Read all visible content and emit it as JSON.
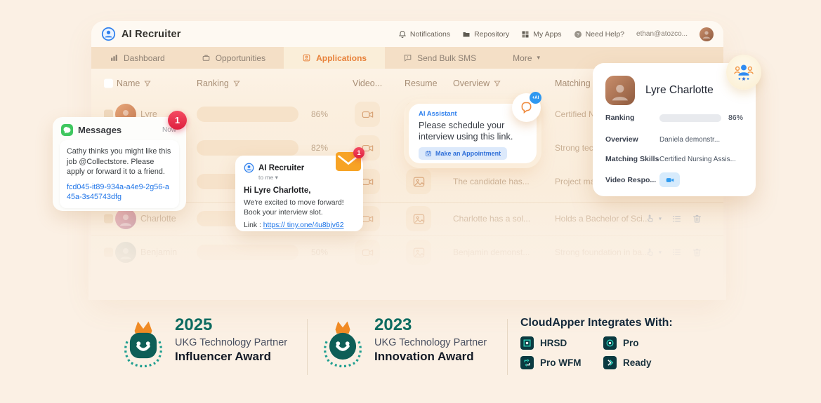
{
  "colors": {
    "accent_orange": "#E8823B",
    "accent_blue": "#2F80ED",
    "ukg_teal": "#0D6B60",
    "badge_red": "#DE1F3F",
    "messages_green": "#3FC75F",
    "progress_fill": "#F0B78B"
  },
  "app": {
    "title": "AI Recruiter",
    "nav": {
      "notifications": "Notifications",
      "repository": "Repository",
      "my_apps": "My Apps",
      "need_help": "Need Help?",
      "user_email": "ethan@atozco..."
    },
    "tabs": {
      "dashboard": "Dashboard",
      "opportunities": "Opportunities",
      "applications": "Applications",
      "send_bulk_sms": "Send Bulk SMS",
      "more": "More"
    }
  },
  "table": {
    "headers": {
      "name": "Name",
      "ranking": "Ranking",
      "video": "Video...",
      "resume": "Resume",
      "overview": "Overview",
      "matching": "Matching Sk..."
    },
    "rows": [
      {
        "name": "Lyre",
        "pct": "86%",
        "bar_pct": 86,
        "overview": "",
        "matching": "Certified Nurs..."
      },
      {
        "name": "",
        "pct": "82%",
        "bar_pct": 82,
        "overview": "",
        "matching": "Strong techni..."
      },
      {
        "name": "",
        "pct": "",
        "bar_pct": 65,
        "overview": "The candidate has...",
        "matching": "Project mana..."
      },
      {
        "name": "Charlotte",
        "pct": "",
        "bar_pct": 70,
        "overview": "Charlotte has a sol...",
        "matching": "Holds a Bachelor of Sci..."
      },
      {
        "name": "Benjamin",
        "pct": "50%",
        "bar_pct": 50,
        "overview": "Benjamin demonst...",
        "matching": "Strong foundation in ba..."
      }
    ]
  },
  "messages_card": {
    "app_name": "Messages",
    "time": "Now",
    "badge": "1",
    "body": "Cathy thinks you might like this job @Collectstore. Please apply or forward it to a friend.",
    "link": "fcd045-it89-934a-a4e9-2g56-a45a-3s45743dfg"
  },
  "email_card": {
    "sender": "AI Recruiter",
    "to_line": "to me",
    "caret": "▾",
    "badge": "1",
    "greeting": "Hi Lyre Charlotte,",
    "line1": "We're excited to move forward!",
    "line2": "Book your interview slot.",
    "link_label": "Link :",
    "link": "https:// tiny.one/4u8bjv62"
  },
  "assistant_card": {
    "label": "AI Assistant",
    "message": "Please schedule your interview using this link.",
    "button": "Make an Appointment",
    "ai_badge": "+AI"
  },
  "profile_card": {
    "name": "Lyre Charlotte",
    "ranking_label": "Ranking",
    "ranking_pct": 86,
    "ranking_value": "86%",
    "overview_label": "Overview",
    "overview_value": "Daniela demonstr...",
    "matching_label": "Matching Skills",
    "matching_value": "Certified Nursing Assis...",
    "video_label": "Video Respo..."
  },
  "awards": [
    {
      "year": "2025",
      "org": "UKG Technology Partner",
      "name": "Influencer Award"
    },
    {
      "year": "2023",
      "org": "UKG Technology Partner",
      "name": "Innovation Award"
    }
  ],
  "integrations": {
    "title": "CloudApper Integrates With:",
    "items": [
      {
        "label": "HRSD"
      },
      {
        "label": "Pro"
      },
      {
        "label": "Pro WFM"
      },
      {
        "label": "Ready"
      }
    ]
  },
  "misc": {
    "more_caret": "▾",
    "tome_caret": "▾",
    "action_caret": "▾"
  }
}
